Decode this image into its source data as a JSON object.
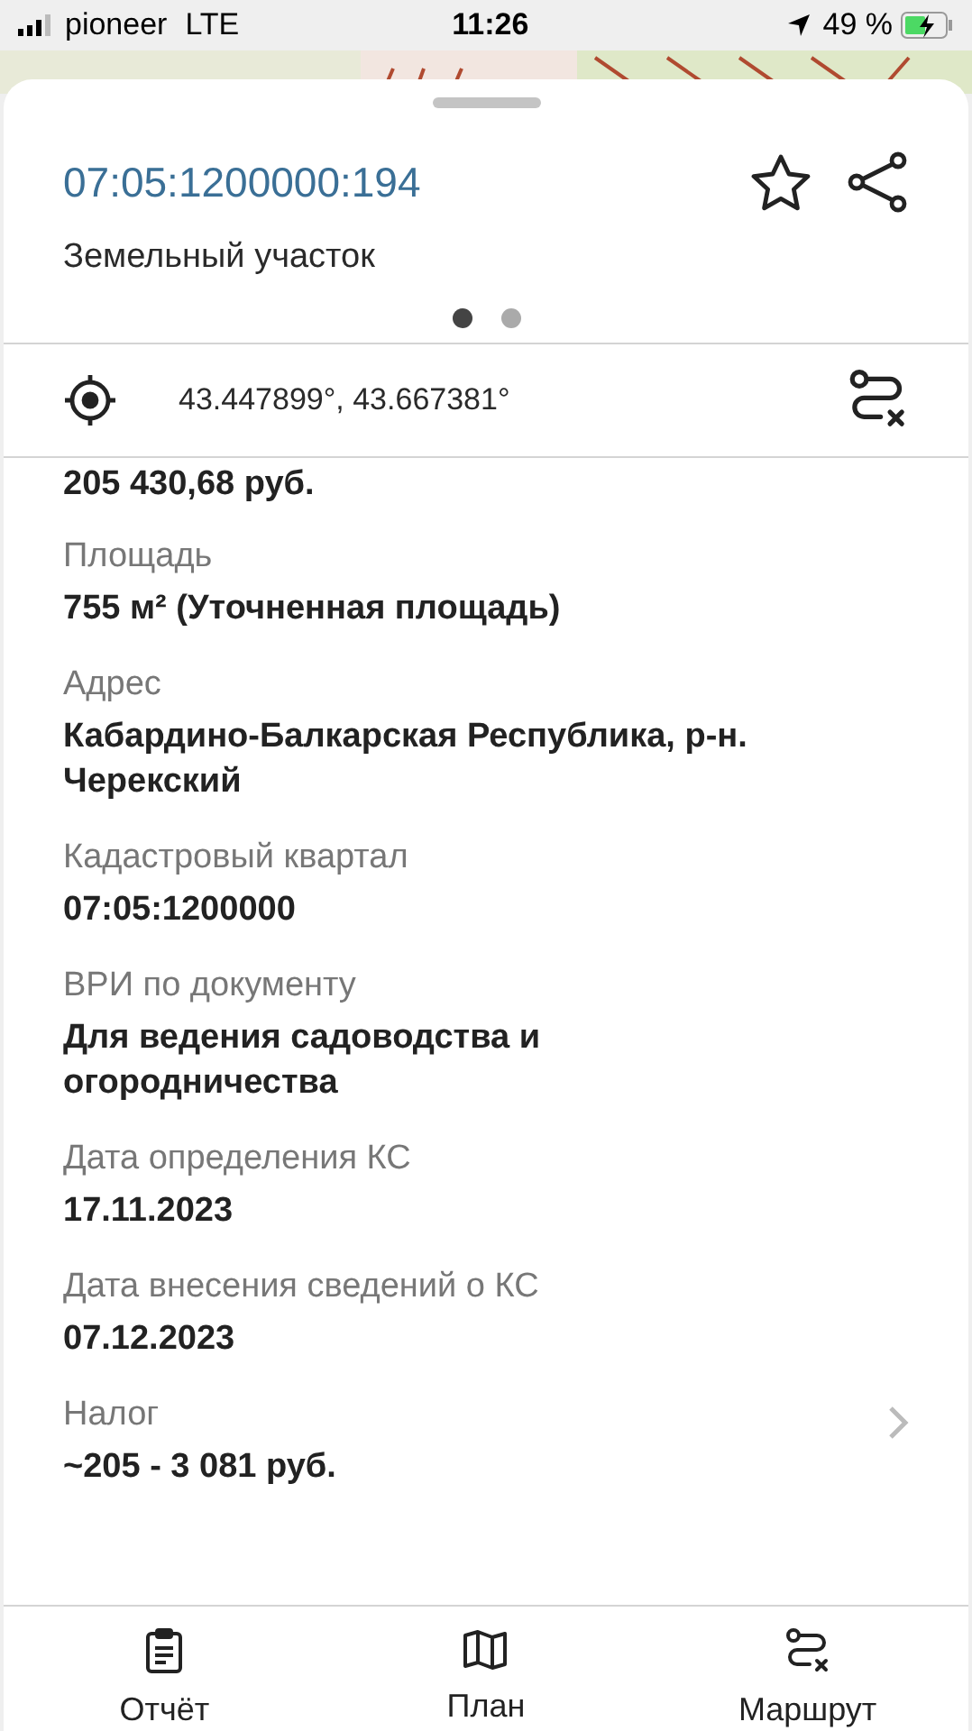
{
  "status_bar": {
    "carrier": "pioneer",
    "network": "LTE",
    "time": "11:26",
    "battery": "49 %"
  },
  "sheet": {
    "title": "07:05:1200000:194",
    "subtitle": "Земельный участок",
    "pages": [
      {
        "selected": true
      },
      {
        "selected": false
      }
    ],
    "coordinates": "43.447899°, 43.667381°",
    "fields": [
      {
        "kind": "text",
        "value": "205 430,68 руб."
      },
      {
        "kind": "text",
        "label": "Площадь",
        "value": "755 м² (Уточненная площадь)"
      },
      {
        "kind": "text",
        "label": "Адрес",
        "value": "Кабардино-Балкарская Республика, р-н. Черекский"
      },
      {
        "kind": "text",
        "label": "Кадастровый квартал",
        "value": "07:05:1200000"
      },
      {
        "kind": "text",
        "label": "ВРИ по документу",
        "value": "Для ведения садоводства и огородничества"
      },
      {
        "kind": "text",
        "label": "Дата определения КС",
        "value": "17.11.2023"
      },
      {
        "kind": "text",
        "label": "Дата внесения сведений о КС",
        "value": "07.12.2023"
      },
      {
        "kind": "link",
        "label": "Налог",
        "value": "~205 - 3 081 руб."
      }
    ]
  },
  "tab_bar": [
    {
      "label": "Отчёт"
    },
    {
      "label": "План"
    },
    {
      "label": "Маршрут"
    }
  ]
}
